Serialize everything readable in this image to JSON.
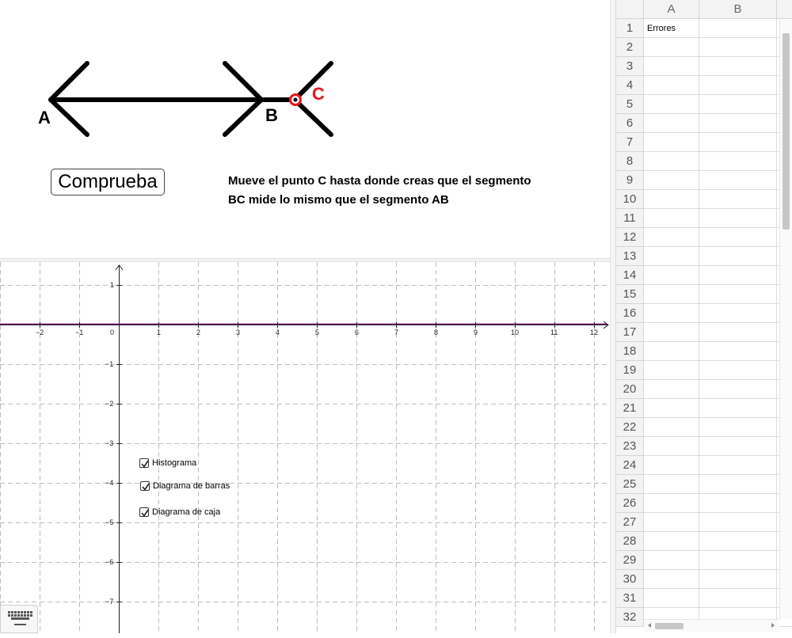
{
  "construction": {
    "point_labels": {
      "a": "A",
      "b": "B",
      "c": "C"
    },
    "button_label": "Comprueba",
    "instructions": [
      "Mueve el punto C hasta donde creas que el segmento",
      "BC mide lo mismo que el segmento AB"
    ],
    "colors": {
      "segment": "#000000",
      "point_c": "#e8141b"
    }
  },
  "graph": {
    "x_ticks": [
      "−2",
      "−1",
      "0",
      "1",
      "2",
      "3",
      "4",
      "5",
      "6",
      "7",
      "8",
      "9",
      "10",
      "11",
      "12"
    ],
    "y_ticks": [
      "1",
      "−1",
      "−2",
      "−3",
      "−4",
      "−5",
      "−6",
      "−7"
    ],
    "line_color": "#660066",
    "checkboxes": [
      {
        "label": "Histograma",
        "checked": true
      },
      {
        "label": "Diagrama de barras",
        "checked": true
      },
      {
        "label": "Diagrama de caja",
        "checked": true
      }
    ]
  },
  "spreadsheet": {
    "columns": [
      "A",
      "B"
    ],
    "rows": [
      "1",
      "2",
      "3",
      "4",
      "5",
      "6",
      "7",
      "8",
      "9",
      "10",
      "11",
      "12",
      "13",
      "14",
      "15",
      "16",
      "17",
      "18",
      "19",
      "20",
      "21",
      "22",
      "23",
      "24",
      "25",
      "26",
      "27",
      "28",
      "29",
      "30",
      "31",
      "32"
    ],
    "cells": {
      "A1": "Errores"
    }
  },
  "toolbar": {
    "keyboard_icon": "keyboard-icon"
  }
}
